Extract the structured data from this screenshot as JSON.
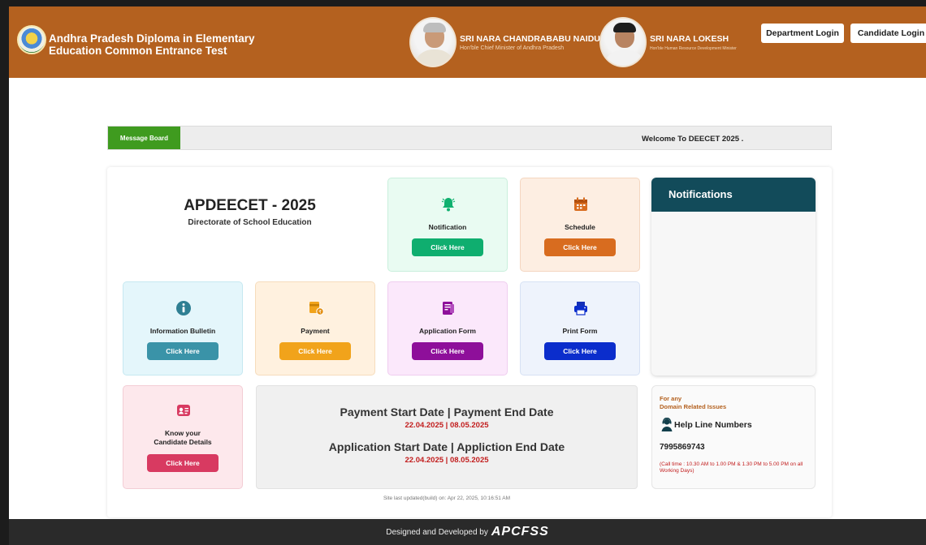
{
  "header": {
    "title_line1": "Andhra Pradesh Diploma in Elementary",
    "title_line2": "Education Common Entrance Test",
    "leaders": [
      {
        "name": "SRI NARA CHANDRABABU NAIDU",
        "role": "Hon'ble Chief Minister of Andhra Pradesh"
      },
      {
        "name": "SRI NARA LOKESH",
        "role": "Hon'ble Human Resource Development Minister"
      }
    ],
    "buttons": {
      "department": "Department Login",
      "candidate": "Candidate Login"
    }
  },
  "message_board": {
    "label": "Message Board",
    "text": "Welcome To DEECET 2025 ."
  },
  "brand": {
    "title": "APDEECET - 2025",
    "subtitle": "Directorate of School Education"
  },
  "cards": {
    "notification": {
      "label": "Notification",
      "button": "Click Here",
      "color": "#0fae6f",
      "icon": "bell-icon"
    },
    "schedule": {
      "label": "Schedule",
      "button": "Click Here",
      "color": "#d86c1f",
      "icon": "calendar-icon"
    },
    "info_bulletin": {
      "label": "Information Bulletin",
      "button": "Click Here",
      "color": "#3a93a8",
      "icon": "info-icon"
    },
    "payment": {
      "label": "Payment",
      "button": "Click Here",
      "color": "#f1a31b",
      "icon": "payment-icon"
    },
    "application_form": {
      "label": "Application Form",
      "button": "Click Here",
      "color": "#8e0f9a",
      "icon": "document-icon"
    },
    "print_form": {
      "label": "Print Form",
      "button": "Click Here",
      "color": "#0b2dcc",
      "icon": "printer-icon"
    },
    "candidate_details": {
      "label_line1": "Know your",
      "label_line2": "Candidate Details",
      "button": "Click Here",
      "color": "#d83a61",
      "icon": "id-card-icon"
    }
  },
  "dates": {
    "payment_heading": "Payment Start Date | Payment End Date",
    "payment_dates": "22.04.2025 | 08.05.2025",
    "application_heading": "Application Start Date | Appliction End Date",
    "application_dates": "22.04.2025 | 08.05.2025"
  },
  "notifications": {
    "title": "Notifications"
  },
  "help": {
    "line1": "For any",
    "line2": "Domain Related Issues",
    "title": "Help Line Numbers",
    "phone": "7995869743",
    "note": "(Call time : 10.30 AM to 1.00 PM & 1.30 PM to 5.00 PM on all Working Days)"
  },
  "site_updated": "Site last updated(build) on: Apr 22, 2025, 10:16:51 AM",
  "footer": {
    "text": "Designed and Developed by",
    "brand": "APCFSS"
  }
}
